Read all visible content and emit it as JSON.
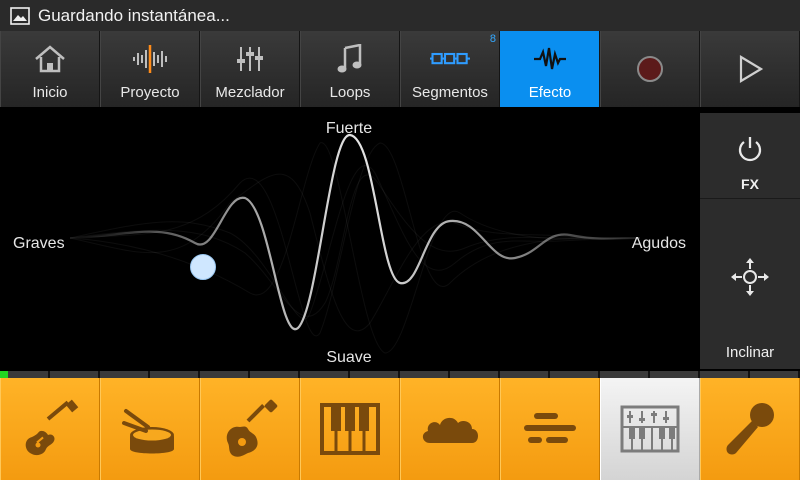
{
  "status_bar": {
    "title": "Guardando instantánea..."
  },
  "toolbar": {
    "items": [
      {
        "label": "Inicio",
        "icon": "home-icon"
      },
      {
        "label": "Proyecto",
        "icon": "waveform-icon"
      },
      {
        "label": "Mezclador",
        "icon": "mixer-sliders-icon"
      },
      {
        "label": "Loops",
        "icon": "music-note-icon"
      },
      {
        "label": "Segmentos",
        "icon": "segments-icon",
        "badge": "8"
      },
      {
        "label": "Efecto",
        "icon": "effect-wave-icon",
        "active": true
      },
      {
        "label": "",
        "icon": "record-icon"
      },
      {
        "label": "",
        "icon": "play-icon"
      }
    ],
    "accent_color": "#0a8ff0",
    "badge_color": "#33a8ff"
  },
  "effect_pad": {
    "top_label": "Fuerte",
    "bottom_label": "Suave",
    "left_label": "Graves",
    "right_label": "Agudos"
  },
  "side_panel": {
    "fx_label": "FX",
    "tilt_label": "Inclinar"
  },
  "progress": {
    "value": 0.01,
    "color": "#21d621"
  },
  "instruments": {
    "items": [
      {
        "icon": "electric-guitar-icon"
      },
      {
        "icon": "drum-icon"
      },
      {
        "icon": "acoustic-guitar-icon"
      },
      {
        "icon": "piano-keys-icon"
      },
      {
        "icon": "cloud-pad-icon"
      },
      {
        "icon": "bass-lines-icon"
      },
      {
        "icon": "synth-keyboard-icon",
        "selected": true
      },
      {
        "icon": "microphone-icon"
      }
    ],
    "color": "#f49b10"
  }
}
